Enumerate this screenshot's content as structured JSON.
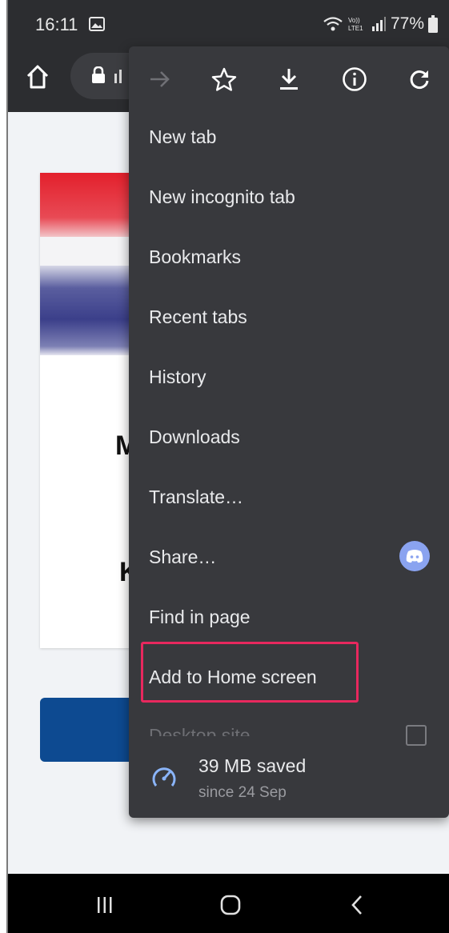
{
  "status_bar": {
    "time": "16:11",
    "volte_label": "Vo))\nLTE1",
    "battery": "77%"
  },
  "toolbar": {
    "icons": [
      "home-icon",
      "lock-icon"
    ]
  },
  "page": {
    "letters": [
      "M",
      "K"
    ],
    "flag_colors": {
      "red": "#e3202c",
      "white": "#ffffff",
      "blue": "#3b3f8a"
    },
    "cta_color": "#0d4a91"
  },
  "menu": {
    "top_icons": [
      "forward-icon",
      "star-icon",
      "download-icon",
      "info-icon",
      "reload-icon"
    ],
    "items": [
      {
        "label": "New tab"
      },
      {
        "label": "New incognito tab"
      },
      {
        "label": "Bookmarks"
      },
      {
        "label": "Recent tabs"
      },
      {
        "label": "History"
      },
      {
        "label": "Downloads"
      },
      {
        "label": "Translate…"
      },
      {
        "label": "Share…"
      },
      {
        "label": "Find in page"
      },
      {
        "label": "Add to Home screen"
      }
    ],
    "faded_item": "Desktop site",
    "saved": {
      "title": "39 MB saved",
      "subtitle": "since 24 Sep"
    },
    "highlight_color": "#e8285e"
  },
  "navbar": {
    "icons": [
      "recent-apps-icon",
      "home-nav-icon",
      "back-nav-icon"
    ]
  }
}
